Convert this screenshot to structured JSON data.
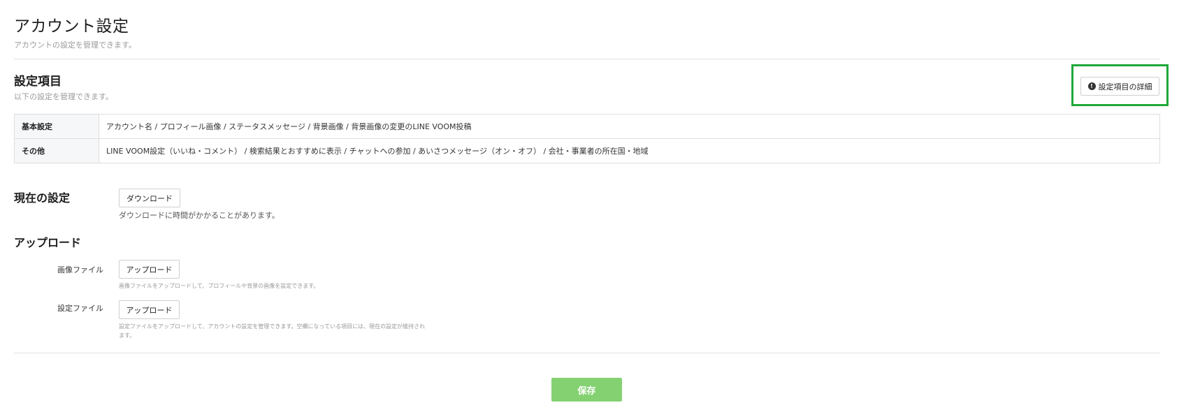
{
  "header": {
    "title": "アカウント設定",
    "subtitle": "アカウントの設定を管理できます。"
  },
  "settings_items": {
    "title": "設定項目",
    "subtitle": "以下の設定を管理できます。",
    "detail_button_label": "設定項目の詳細",
    "detail_button_icon": "info-icon",
    "highlight_color": "#1fa839",
    "rows": [
      {
        "label": "基本設定",
        "value": "アカウント名 / プロフィール画像 / ステータスメッセージ / 背景画像 / 背景画像の変更のLINE VOOM投稿"
      },
      {
        "label": "その他",
        "value": "LINE VOOM設定（いいね・コメント） / 検索結果とおすすめに表示 / チャットへの参加 / あいさつメッセージ（オン・オフ） / 会社・事業者の所在国・地域"
      }
    ]
  },
  "current_settings": {
    "title": "現在の設定",
    "download_label": "ダウンロード",
    "download_note": "ダウンロードに時間がかかることがあります。"
  },
  "upload": {
    "title": "アップロード",
    "image_file": {
      "label": "画像ファイル",
      "button_label": "アップロード",
      "note": "画像ファイルをアップロードして、プロフィールや背景の画像を設定できます。"
    },
    "settings_file": {
      "label": "設定ファイル",
      "button_label": "アップロード",
      "note": "設定ファイルをアップロードして、アカウントの設定を管理できます。空欄になっている項目には、現在の設定が維持されます。"
    }
  },
  "footer": {
    "save_label": "保存",
    "save_color": "#84d172"
  }
}
